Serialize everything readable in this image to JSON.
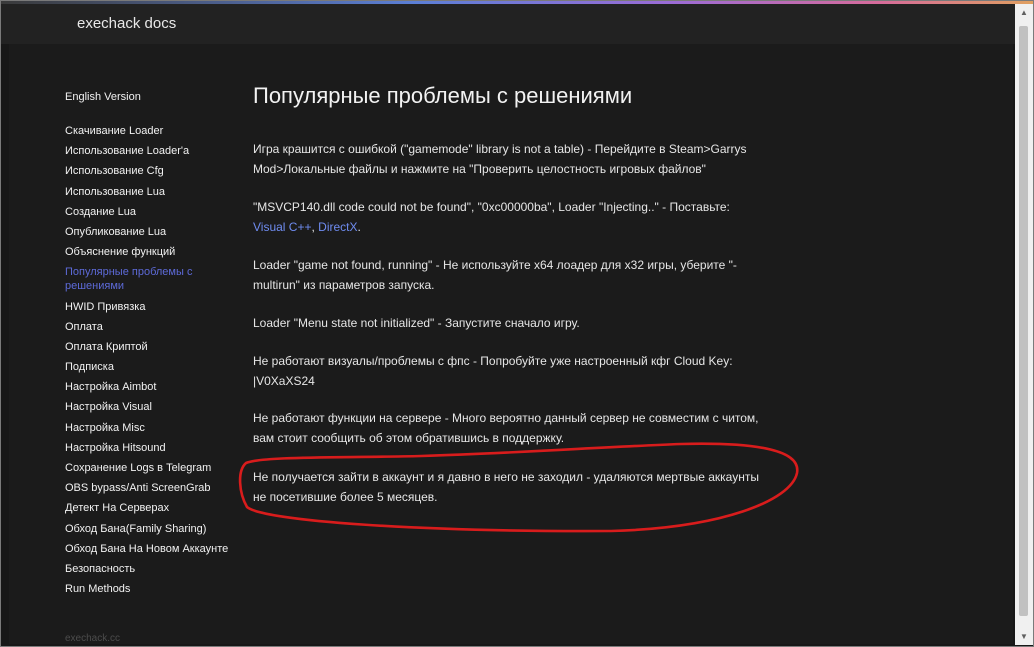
{
  "site": {
    "title": "exechack docs",
    "footer": "exechack.cc"
  },
  "sidebar": {
    "language_link": "English Version",
    "items": [
      {
        "label": "Скачивание Loader"
      },
      {
        "label": "Использование Loader'а"
      },
      {
        "label": "Использование Cfg"
      },
      {
        "label": "Использование Lua"
      },
      {
        "label": "Создание Lua"
      },
      {
        "label": "Опубликование Lua"
      },
      {
        "label": "Объяснение функций"
      },
      {
        "label": "Популярные проблемы с решениями",
        "active": true
      },
      {
        "label": "HWID Привязка"
      },
      {
        "label": "Оплата"
      },
      {
        "label": "Оплата Криптой"
      },
      {
        "label": "Подписка"
      },
      {
        "label": "Настройка Aimbot"
      },
      {
        "label": "Настройка Visual"
      },
      {
        "label": "Настройка Misc"
      },
      {
        "label": "Настройка Hitsound"
      },
      {
        "label": "Сохранение Logs в Telegram"
      },
      {
        "label": "OBS bypass/Anti ScreenGrab"
      },
      {
        "label": "Детект На Серверах"
      },
      {
        "label": "Обход Бана(Family Sharing)"
      },
      {
        "label": "Обход Бана На Новом Аккаунте"
      },
      {
        "label": "Безопасность"
      },
      {
        "label": "Run Methods"
      }
    ]
  },
  "main": {
    "title": "Популярные проблемы с решениями",
    "issues": [
      {
        "text": "Игра крашится с ошибкой (\"gamemode\" library is not a table) - Перейдите в Steam>Garrys Mod>Локальные файлы и нажмите на \"Проверить целостность игровых файлов\""
      },
      {
        "text": "\"MSVCP140.dll code could not be found\", \"0xc00000ba\", Loader \"Injecting..\" - Поставьте: ",
        "link1": "Visual C++",
        "sep": ", ",
        "link2": "DirectX",
        "end": "."
      },
      {
        "text": "Loader \"game not found, running\" - Не используйте x64 лоадер для x32 игры, уберите \"-multirun\" из параметров запуска."
      },
      {
        "text": "Loader \"Menu state not initialized\" - Запустите сначало игру."
      },
      {
        "text": "Не работают визуалы/проблемы с фпс - Попробуйте уже настроенный кфг Cloud Key: |V0XaXS24"
      },
      {
        "text": "Не работают функции на сервере - Много вероятно данный сервер не совместим с читом, вам стоит сообщить об этом обратившись в поддержку."
      },
      {
        "text": "Не получается зайти в аккаунт и я давно в него не заходил - удаляются мертвые аккаунты не посетившие более 5 месяцев."
      }
    ]
  },
  "colors": {
    "background": "#171717",
    "text": "#e6e6e6",
    "link": "#6f8cf0",
    "active_nav": "#5d6ad8",
    "annotation": "#d81c1c"
  },
  "icons": {
    "scroll_up": "triangle-up-icon",
    "scroll_down": "triangle-down-icon"
  }
}
